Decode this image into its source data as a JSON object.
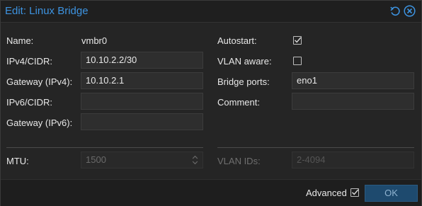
{
  "window": {
    "title": "Edit: Linux Bridge",
    "reset_icon": "undo-icon",
    "close_icon": "close-circle-icon"
  },
  "left": {
    "name_label": "Name:",
    "name_value": "vmbr0",
    "ipv4_label": "IPv4/CIDR:",
    "ipv4_value": "10.10.2.2/30",
    "gateway4_label": "Gateway (IPv4):",
    "gateway4_value": "10.10.2.1",
    "ipv6_label": "IPv6/CIDR:",
    "ipv6_value": "",
    "gateway6_label": "Gateway (IPv6):",
    "gateway6_value": ""
  },
  "right": {
    "autostart_label": "Autostart:",
    "autostart_checked": true,
    "vlan_aware_label": "VLAN aware:",
    "vlan_aware_checked": false,
    "bridge_ports_label": "Bridge ports:",
    "bridge_ports_value": "eno1",
    "comment_label": "Comment:",
    "comment_value": ""
  },
  "advanced_section": {
    "mtu_label": "MTU:",
    "mtu_value": "1500",
    "vlan_ids_label": "VLAN IDs:",
    "vlan_ids_value": "2-4094"
  },
  "footer": {
    "advanced_label": "Advanced",
    "advanced_checked": true,
    "ok_label": "OK"
  },
  "colors": {
    "accent": "#3d93e0",
    "background": "#252525",
    "field": "#2e2e2e",
    "ok_button": "#1e4a6e"
  }
}
